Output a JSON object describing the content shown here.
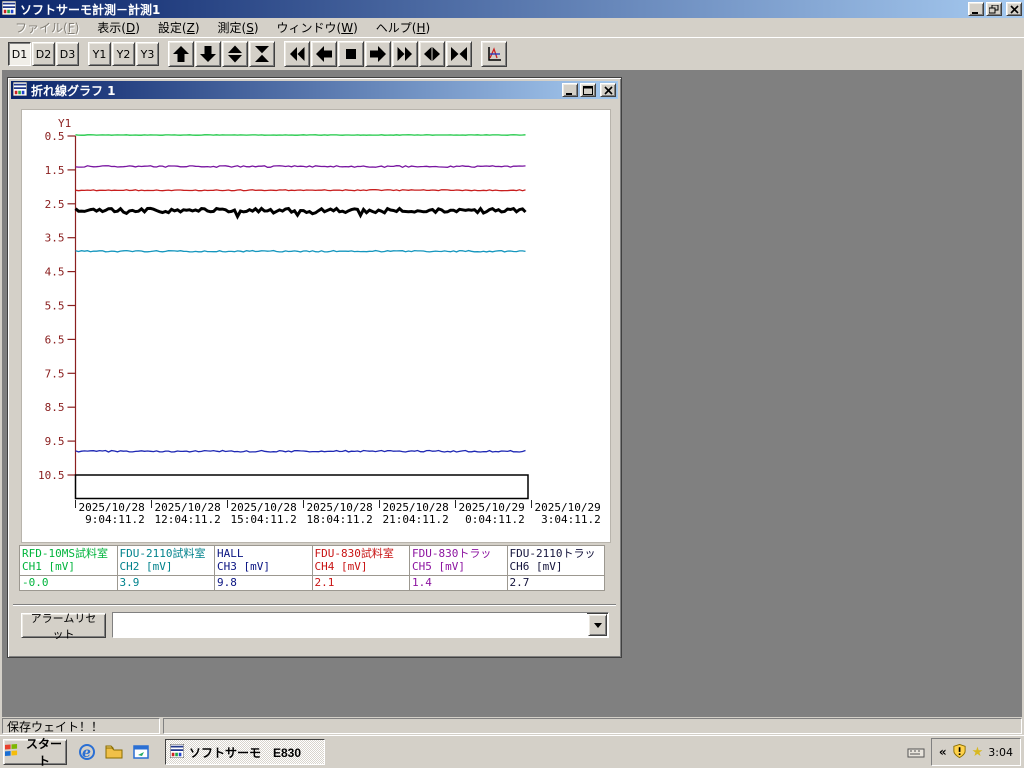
{
  "window": {
    "title": "ソフトサーモ計測－計測1"
  },
  "menu": {
    "items": [
      {
        "text": "ファイル",
        "mnemonic": "F",
        "disabled": true
      },
      {
        "text": "表示",
        "mnemonic": "D",
        "disabled": false
      },
      {
        "text": "設定",
        "mnemonic": "Z",
        "disabled": false
      },
      {
        "text": "測定",
        "mnemonic": "S",
        "disabled": false
      },
      {
        "text": "ウィンドウ",
        "mnemonic": "W",
        "disabled": false
      },
      {
        "text": "ヘルプ",
        "mnemonic": "H",
        "disabled": false
      }
    ]
  },
  "toolbar": {
    "groups": [
      {
        "type": "text",
        "buttons": [
          {
            "label": "D1",
            "pressed": true
          },
          {
            "label": "D2",
            "pressed": false
          },
          {
            "label": "D3",
            "pressed": false
          }
        ]
      },
      {
        "type": "text",
        "buttons": [
          {
            "label": "Y1",
            "pressed": false
          },
          {
            "label": "Y2",
            "pressed": false
          },
          {
            "label": "Y3",
            "pressed": false
          }
        ]
      },
      {
        "type": "icon",
        "buttons": [
          {
            "icon": "arrow-up-icon"
          },
          {
            "icon": "arrow-down-icon"
          },
          {
            "icon": "arrows-out-vertical-icon"
          },
          {
            "icon": "arrows-in-vertical-icon"
          }
        ]
      },
      {
        "type": "icon",
        "buttons": [
          {
            "icon": "double-left-icon"
          },
          {
            "icon": "arrow-left-icon"
          },
          {
            "icon": "stop-square-icon"
          },
          {
            "icon": "arrow-right-icon"
          },
          {
            "icon": "double-right-icon"
          },
          {
            "icon": "arrows-out-horizontal-icon"
          },
          {
            "icon": "arrows-in-horizontal-icon"
          }
        ]
      },
      {
        "type": "icon",
        "buttons": [
          {
            "icon": "chart-icon"
          }
        ]
      }
    ]
  },
  "graph_window": {
    "title": "折れ線グラフ 1",
    "alarm_reset_label": "アラームリセット",
    "combo_value": ""
  },
  "chart_data": {
    "type": "line",
    "title": "折れ線グラフ 1",
    "y_axis": {
      "label": "Y1",
      "min": 0.5,
      "max": 10.5,
      "direction": "increases-downward",
      "ticks": [
        "0.5",
        "1.5",
        "2.5",
        "3.5",
        "4.5",
        "5.5",
        "6.5",
        "7.5",
        "8.5",
        "9.5",
        "10.5"
      ],
      "color": "#8b2020"
    },
    "x_axis": {
      "ticks": [
        {
          "date": "2025/10/28",
          "time": "9:04:11.2"
        },
        {
          "date": "2025/10/28",
          "time": "12:04:11.2"
        },
        {
          "date": "2025/10/28",
          "time": "15:04:11.2"
        },
        {
          "date": "2025/10/28",
          "time": "18:04:11.2"
        },
        {
          "date": "2025/10/28",
          "time": "21:04:11.2"
        },
        {
          "date": "2025/10/29",
          "time": "0:04:11.2"
        },
        {
          "date": "2025/10/29",
          "time": "3:04:11.2"
        }
      ]
    },
    "series": [
      {
        "name": "RFD-10MS試料室",
        "channel_label": "CH1 [mV]",
        "value": -0.0,
        "value_display": "-0.0",
        "color": "#1ec846",
        "label_color": "#00b43c",
        "width": 1.3,
        "jitter": 0.2
      },
      {
        "name": "FDU-2110試料室",
        "channel_label": "CH2 [mV]",
        "value": 3.9,
        "value_display": "3.9",
        "color": "#1496be",
        "label_color": "#00828c",
        "width": 1.3,
        "jitter": 0.7
      },
      {
        "name": "HALL",
        "channel_label": "CH3 [mV]",
        "value": 9.8,
        "value_display": "9.8",
        "color": "#1e28b4",
        "label_color": "#0a1482",
        "width": 1.3,
        "jitter": 0.8
      },
      {
        "name": "FDU-830試料室",
        "channel_label": "CH4 [mV]",
        "value": 2.1,
        "value_display": "2.1",
        "color": "#c81e1e",
        "label_color": "#c81414",
        "width": 1.3,
        "jitter": 0.5
      },
      {
        "name": "FDU-830トラッ",
        "channel_label": "CH5 [mV]",
        "value": 1.4,
        "value_display": "1.4",
        "color": "#7814a0",
        "label_color": "#8c14a0",
        "width": 1.3,
        "jitter": 0.8
      },
      {
        "name": "FDU-2110トラッ",
        "channel_label": "CH6 [mV]",
        "value": 2.7,
        "value_display": "2.7",
        "color": "#000000",
        "label_color": "#14143c",
        "width": 3,
        "jitter": 2.2
      }
    ],
    "range_box": true
  },
  "statusbar": {
    "text": "保存ウェイト！！"
  },
  "taskbar": {
    "start_label": "スタート",
    "quick_launch": [
      "ie-icon",
      "folder-icon",
      "window-icon"
    ],
    "task_button": {
      "label": "ソフトサーモ　E830",
      "active": true
    },
    "tray": {
      "chevron": "«",
      "icons": [
        "keyboard-icon",
        "shield-alert-icon",
        "star-icon"
      ],
      "clock": "3:04"
    }
  }
}
